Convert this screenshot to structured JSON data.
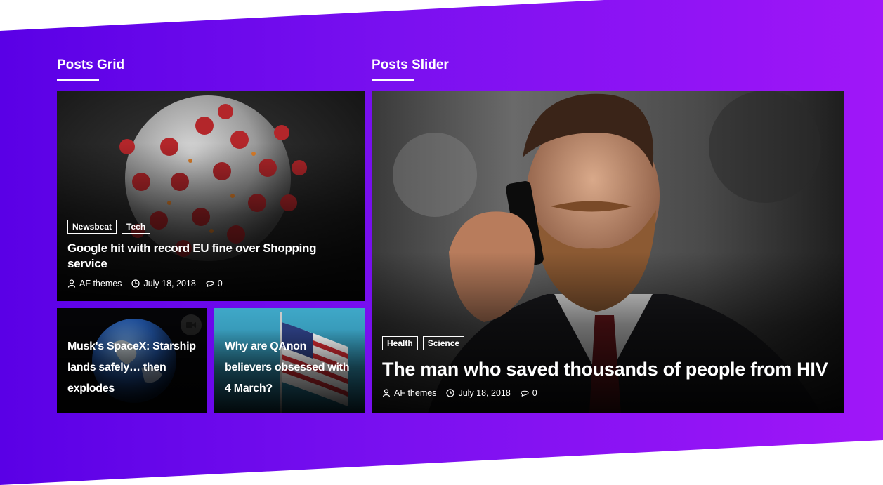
{
  "sections": {
    "grid_title": "Posts Grid",
    "slider_title": "Posts Slider"
  },
  "grid": {
    "main": {
      "tags": [
        "Newsbeat",
        "Tech"
      ],
      "title": "Google hit with record EU fine over Shopping service",
      "author": "AF themes",
      "date": "July 18, 2018",
      "comments": "0"
    },
    "small_left": {
      "title": "Musk's SpaceX: Starship lands safely… then explodes"
    },
    "small_right": {
      "title": "Why are QAnon believers obsessed with 4 March?"
    }
  },
  "slider": {
    "tags": [
      "Health",
      "Science"
    ],
    "title": "The man who saved thousands of people from HIV",
    "author": "AF themes",
    "date": "July 18, 2018",
    "comments": "0"
  },
  "colors": {
    "gradient_start": "#5a00e6",
    "gradient_end": "#a016f8"
  }
}
